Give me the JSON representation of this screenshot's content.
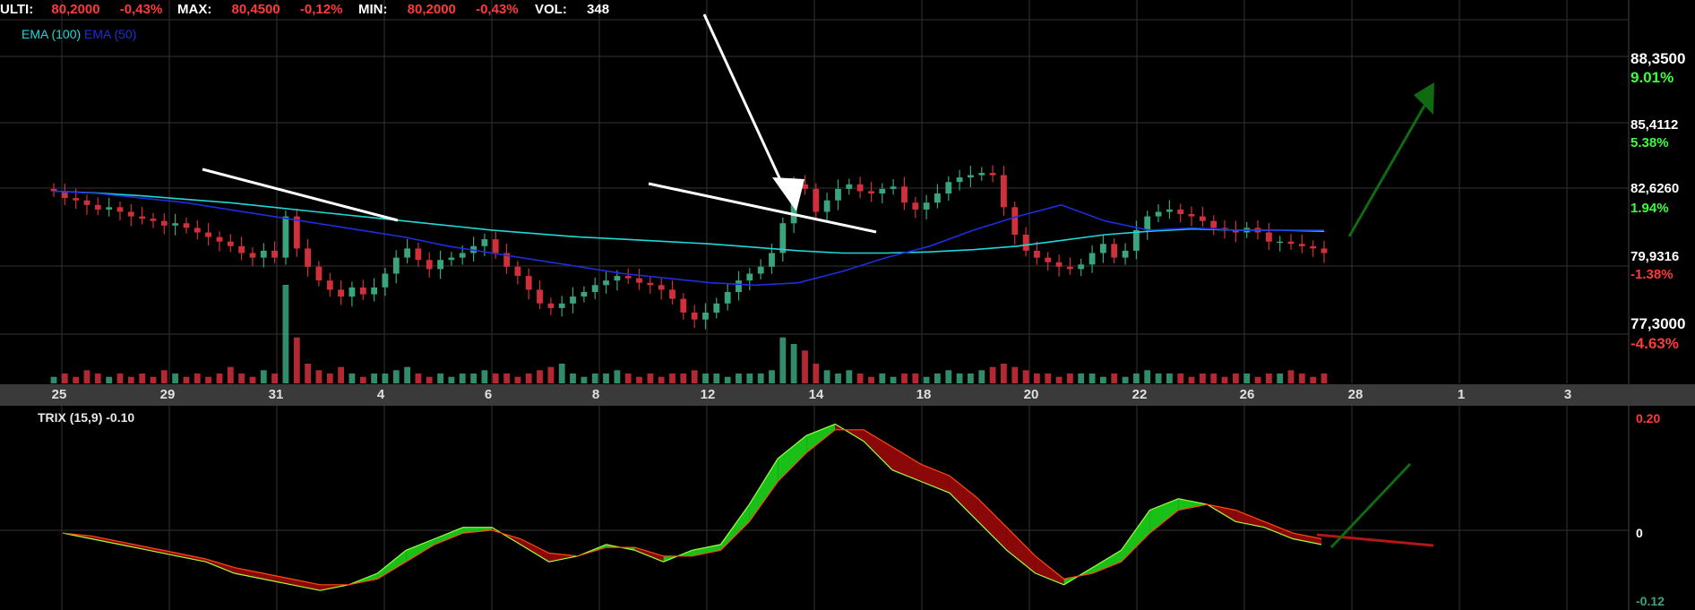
{
  "header": {
    "ulti_label": "ULTI:",
    "ulti_value": "80,2000",
    "ulti_change": "-0,43%",
    "max_label": "MAX:",
    "max_value": "80,4500",
    "max_change": "-0,12%",
    "min_label": "MIN:",
    "min_value": "80,2000",
    "min_change": "-0,43%",
    "vol_label": "VOL:",
    "vol_value": "348"
  },
  "legend": {
    "ema100": "EMA (100)",
    "ema50": "EMA (50)"
  },
  "trix_label": "TRIX (15,9) -0.10",
  "colors": {
    "bg": "#000000",
    "up": "#3aa57c",
    "down": "#d1303a",
    "ema100": "#20d8d8",
    "ema50": "#1c2ee0",
    "trix_up": "#18c018",
    "trix_down": "#8a0808",
    "arrow_green": "#0f6a12",
    "grid": "#333333"
  },
  "chart_data": [
    {
      "type": "candlestick",
      "x": [
        "25",
        "29",
        "31",
        "4",
        "6",
        "8",
        "12",
        "14",
        "18",
        "20",
        "22",
        "26",
        "28",
        "1",
        "3"
      ],
      "price_labels": [
        {
          "value": "88,3500",
          "pct": "9.01%"
        },
        {
          "value": "85,4112",
          "pct": "5.38%"
        },
        {
          "value": "82,6260",
          "pct": "1.94%"
        },
        {
          "value": "79,9316",
          "pct": "-1.38%"
        },
        {
          "value": "77,3000",
          "pct": "-4.63%"
        }
      ],
      "ylim": [
        76.7,
        88.9
      ],
      "close": [
        82.9,
        82.6,
        82.5,
        82.3,
        82.1,
        82.2,
        82.0,
        81.8,
        81.7,
        81.6,
        81.4,
        81.5,
        81.3,
        81.1,
        80.9,
        80.7,
        80.5,
        80.2,
        80.0,
        80.3,
        80.0,
        81.8,
        80.4,
        79.6,
        79.0,
        78.6,
        78.3,
        78.7,
        78.4,
        78.7,
        79.3,
        80.0,
        80.4,
        79.9,
        79.5,
        79.9,
        80.0,
        80.2,
        80.5,
        80.8,
        80.2,
        79.6,
        79.2,
        78.6,
        78.0,
        77.8,
        78.0,
        78.3,
        78.5,
        78.8,
        79.0,
        79.2,
        79.1,
        78.9,
        78.8,
        78.6,
        78.2,
        77.6,
        77.3,
        77.6,
        78.0,
        78.5,
        79.0,
        79.3,
        79.6,
        80.2,
        81.5,
        83.2,
        83.0,
        82.0,
        82.5,
        83.0,
        83.2,
        82.9,
        82.8,
        83.0,
        83.1,
        82.4,
        82.1,
        82.4,
        82.8,
        83.3,
        83.5,
        83.6,
        83.7,
        83.6,
        82.2,
        81.0,
        80.3,
        80.0,
        79.8,
        79.6,
        79.5,
        79.7,
        80.2,
        80.6,
        80.0,
        80.3,
        81.2,
        81.8,
        82.0,
        82.1,
        81.9,
        81.8,
        81.6,
        81.3,
        81.2,
        81.1,
        81.3,
        81.1,
        80.7,
        80.7,
        80.6,
        80.5,
        80.4,
        80.2
      ],
      "ema100": [
        82.9,
        82.82,
        82.7,
        82.55,
        82.4,
        82.2,
        82.0,
        81.8,
        81.6,
        81.4,
        81.2,
        81.05,
        80.9,
        80.8,
        80.7,
        80.6,
        80.45,
        80.3,
        80.2,
        80.2,
        80.25,
        80.35,
        80.5,
        80.75,
        81.0,
        81.15,
        81.25,
        81.2,
        81.2,
        81.15
      ],
      "ema50": [
        82.9,
        82.8,
        82.6,
        82.4,
        82.1,
        81.8,
        81.5,
        81.2,
        80.9,
        80.5,
        80.2,
        79.9,
        79.6,
        79.3,
        79.1,
        78.9,
        78.8,
        78.9,
        79.4,
        80.0,
        80.5,
        81.2,
        81.8,
        82.3,
        81.6,
        81.2,
        81.3,
        81.2,
        81.2,
        81.2
      ],
      "volume": [
        2,
        3,
        2,
        4,
        3,
        2,
        3,
        2,
        3,
        2,
        4,
        3,
        2,
        3,
        2,
        3,
        5,
        3,
        2,
        4,
        3,
        30,
        14,
        6,
        4,
        3,
        5,
        3,
        2,
        3,
        3,
        4,
        5,
        3,
        2,
        3,
        2,
        3,
        3,
        4,
        3,
        3,
        2,
        3,
        4,
        5,
        6,
        3,
        2,
        3,
        3,
        4,
        3,
        2,
        3,
        2,
        3,
        3,
        4,
        3,
        3,
        2,
        3,
        3,
        3,
        4,
        14,
        12,
        10,
        6,
        4,
        3,
        4,
        3,
        2,
        3,
        2,
        3,
        3,
        2,
        3,
        4,
        3,
        3,
        4,
        5,
        6,
        5,
        4,
        3,
        3,
        2,
        3,
        3,
        3,
        2,
        3,
        2,
        3,
        4,
        3,
        3,
        3,
        2,
        3,
        3,
        2,
        3,
        3,
        2,
        3,
        3,
        4,
        3,
        2,
        3
      ]
    },
    {
      "type": "line",
      "title": "TRIX (15,9) -0.10",
      "y_labels": [
        "0.20",
        "0",
        "-0.12"
      ],
      "ylim": [
        -0.12,
        0.2
      ],
      "series": [
        {
          "values": [
            0.0,
            -0.01,
            -0.02,
            -0.03,
            -0.04,
            -0.05,
            -0.07,
            -0.08,
            -0.09,
            -0.1,
            -0.09,
            -0.07,
            -0.03,
            -0.01,
            0.01,
            0.01,
            -0.02,
            -0.05,
            -0.04,
            -0.02,
            -0.03,
            -0.05,
            -0.03,
            -0.02,
            0.05,
            0.13,
            0.17,
            0.19,
            0.16,
            0.11,
            0.09,
            0.07,
            0.02,
            -0.03,
            -0.07,
            -0.09,
            -0.06,
            -0.03,
            0.04,
            0.06,
            0.05,
            0.02,
            0.01,
            -0.01,
            -0.02
          ]
        },
        {
          "values": [
            0.0,
            -0.005,
            -0.015,
            -0.025,
            -0.035,
            -0.045,
            -0.06,
            -0.07,
            -0.08,
            -0.09,
            -0.09,
            -0.08,
            -0.05,
            -0.02,
            0.0,
            0.005,
            -0.01,
            -0.035,
            -0.04,
            -0.025,
            -0.025,
            -0.04,
            -0.04,
            -0.03,
            0.02,
            0.09,
            0.14,
            0.18,
            0.18,
            0.15,
            0.12,
            0.1,
            0.06,
            0.01,
            -0.04,
            -0.08,
            -0.07,
            -0.05,
            0.0,
            0.04,
            0.05,
            0.04,
            0.02,
            0.0,
            -0.01
          ]
        }
      ]
    }
  ]
}
